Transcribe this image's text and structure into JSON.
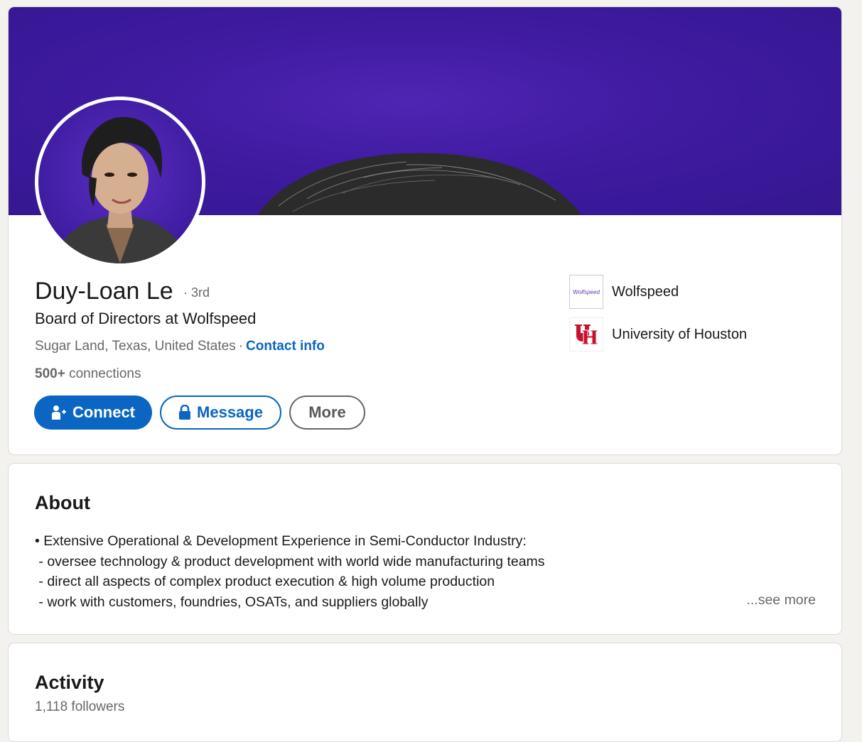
{
  "profile": {
    "name": "Duy-Loan Le",
    "degree": "· 3rd",
    "headline": "Board of Directors at Wolfspeed",
    "location": "Sugar Land, Texas, United States",
    "separator": "·",
    "contact_info": "Contact info",
    "connections_count": "500+",
    "connections_label": "connections",
    "actions": {
      "connect": "Connect",
      "message": "Message",
      "more": "More"
    },
    "organizations": [
      {
        "name": "Wolfspeed",
        "logo_text": "Wolfspeed",
        "icon": "wolfspeed-logo"
      },
      {
        "name": "University of Houston",
        "icon": "uh-logo"
      }
    ],
    "colors": {
      "brand_blue": "#0a66c2",
      "banner_purple": "#3f1ba0",
      "uh_red": "#c8102e"
    }
  },
  "about": {
    "title": "About",
    "lines": [
      "• Extensive Operational & Development Experience in Semi-Conductor Industry:",
      " - oversee technology & product development with world wide manufacturing teams",
      " - direct all aspects of complex product execution & high volume production",
      " - work with customers, foundries, OSATs, and suppliers globally"
    ],
    "see_more": "...see more"
  },
  "activity": {
    "title": "Activity",
    "followers": "1,118 followers"
  }
}
